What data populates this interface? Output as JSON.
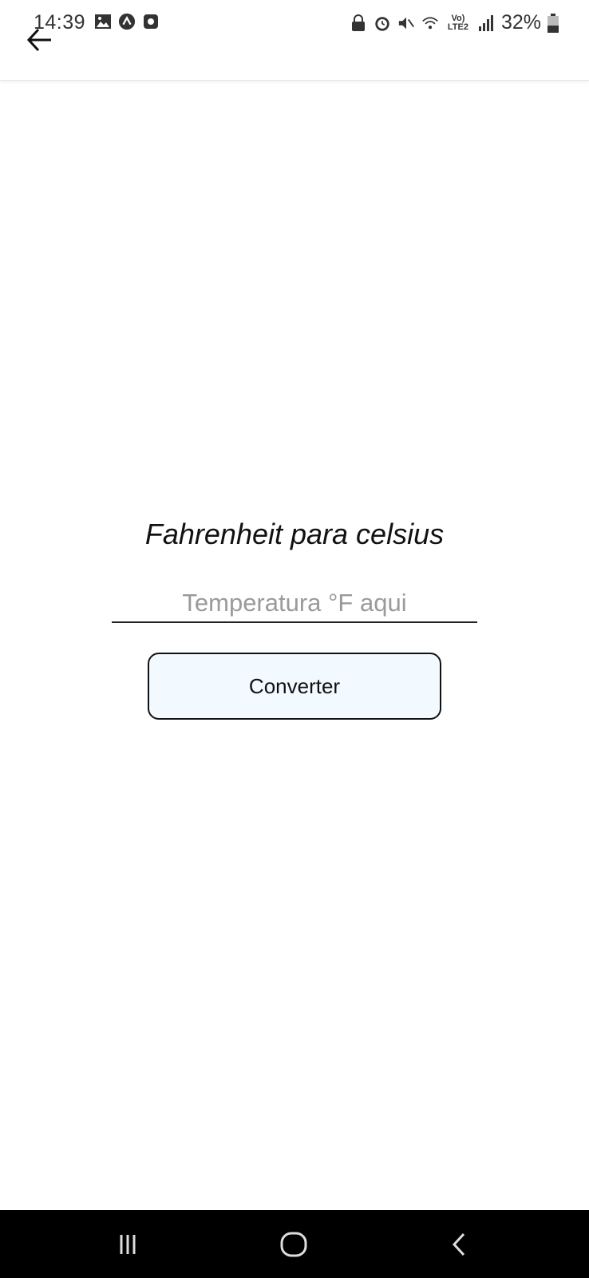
{
  "status_bar": {
    "time": "14:39",
    "battery": "32%",
    "network": "LTE2",
    "left_icons": [
      "gallery-icon",
      "app-a-icon",
      "app-square-icon"
    ],
    "right_icons": [
      "lock-icon",
      "alarm-icon",
      "mute-icon",
      "wifi-icon",
      "volte-icon",
      "signal-icon",
      "battery-icon"
    ]
  },
  "header": {
    "back_icon": "arrow-left-icon"
  },
  "main": {
    "title": "Fahrenheit para celsius",
    "input_placeholder": "Temperatura °F aqui",
    "input_value": "",
    "convert_label": "Converter"
  },
  "nav_bar": {
    "recent_icon": "recent-apps-icon",
    "home_icon": "home-icon",
    "back_icon": "nav-back-icon"
  },
  "colors": {
    "button_bg": "#f2f9ff",
    "nav_bg": "#000000",
    "placeholder": "#9a9a9a"
  }
}
